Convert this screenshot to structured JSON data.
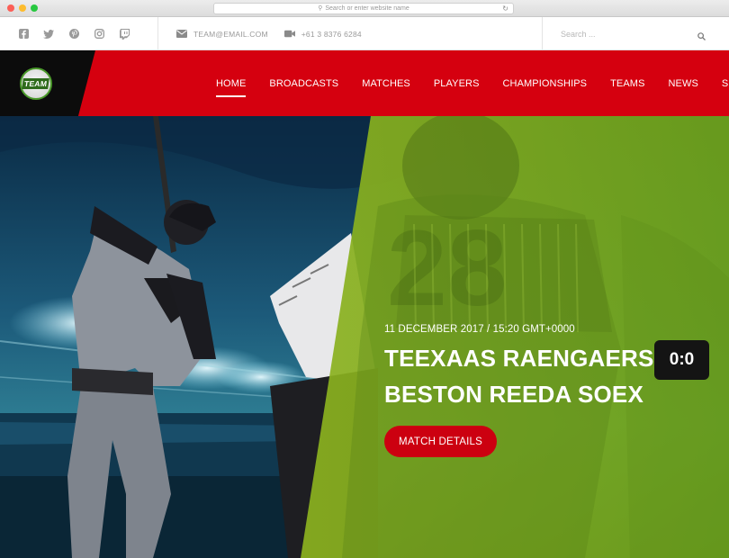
{
  "browser": {
    "url_placeholder": "Search or enter website name"
  },
  "topbar": {
    "social_icons": [
      "facebook-icon",
      "twitter-icon",
      "pinterest-icon",
      "instagram-icon",
      "twitch-icon"
    ],
    "email": "TEAM@EMAIL.COM",
    "phone": "+61 3 8376 6284",
    "search_placeholder": "Search ..."
  },
  "brand": {
    "logo_text": "TEAM"
  },
  "nav": {
    "items": [
      {
        "label": "HOME",
        "active": true
      },
      {
        "label": "BROADCASTS"
      },
      {
        "label": "MATCHES"
      },
      {
        "label": "PLAYERS"
      },
      {
        "label": "CHAMPIONSHIPS"
      },
      {
        "label": "TEAMS"
      },
      {
        "label": "NEWS"
      },
      {
        "label": "SHOP"
      }
    ]
  },
  "hero": {
    "date": "11 DECEMBER 2017 / 15:20 GMT+0000",
    "team1": "TEEXAAS RAENGAERS",
    "team2": "BESTON REEDA SOEX",
    "score": "0:0",
    "button_label": "MATCH DETAILS"
  },
  "colors": {
    "brand_red": "#d5000f",
    "overlay_green": "#7fae1c",
    "dark": "#141414"
  }
}
